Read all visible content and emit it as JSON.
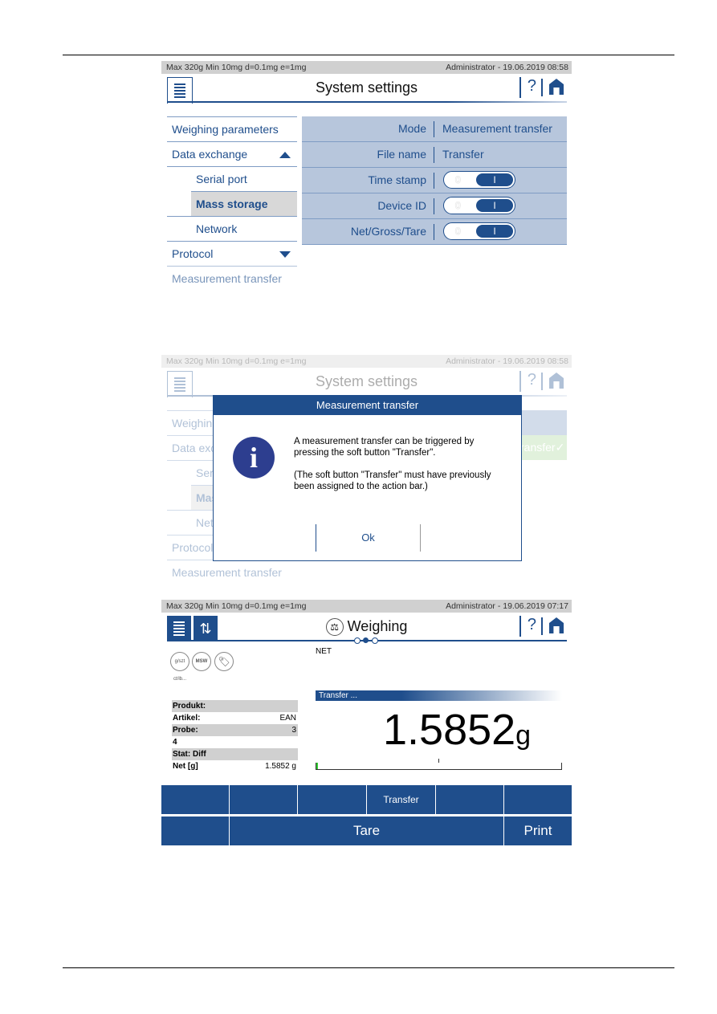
{
  "status": {
    "left": "Max 320g  Min 10mg  d=0.1mg  e=1mg",
    "right1": "Administrator  -  19.06.2019 08:58",
    "right3": "Administrator  -  19.06.2019 07:17"
  },
  "settings": {
    "title": "System settings",
    "help": "?",
    "menu": [
      {
        "label": "Weighing parameters"
      },
      {
        "label": "Data exchange"
      },
      {
        "label": "Serial port"
      },
      {
        "label": "Mass storage"
      },
      {
        "label": "Network"
      },
      {
        "label": "Protocol"
      },
      {
        "label": "Measurement transfer"
      }
    ],
    "rows": [
      {
        "key": "Mode",
        "value": "Measurement transfer"
      },
      {
        "key": "File name",
        "value": "Transfer"
      },
      {
        "key": "Time stamp",
        "off": "0",
        "on": "I"
      },
      {
        "key": "Device ID",
        "off": "0",
        "on": "I"
      },
      {
        "key": "Net/Gross/Tare",
        "off": "0",
        "on": "I"
      }
    ]
  },
  "dialog": {
    "title": "Measurement transfer",
    "text1": "A measurement transfer can be triggered by pressing the soft button \"Transfer\".",
    "text2": "(The soft button \"Transfer\" must have previously been assigned to the action bar.)",
    "ok": "Ok",
    "bg_fragment": "ransfer✓"
  },
  "weighing": {
    "title": "Weighing",
    "net_label": "NET",
    "icons": [
      "g/szt ct/lb...",
      "MSW",
      "tag"
    ],
    "rows": [
      {
        "k": "Produkt:",
        "v": ""
      },
      {
        "k": "Artikel:",
        "v": "EAN"
      },
      {
        "k": "Probe:",
        "v": "3"
      },
      {
        "k": "4",
        "v": ""
      },
      {
        "k": "Stat: Diff",
        "v": ""
      },
      {
        "k": "Net [g]",
        "v": "1.5852 g"
      }
    ],
    "transfer_bar": "Transfer ...",
    "value": "1.5852",
    "unit": "g",
    "soft_buttons": [
      "",
      "",
      "",
      "Transfer",
      "",
      ""
    ],
    "bottom_buttons": {
      "tare": "Tare",
      "print": "Print"
    }
  },
  "colors": {
    "primary": "#1f4e8c",
    "highlight": "#b7c6dc"
  }
}
